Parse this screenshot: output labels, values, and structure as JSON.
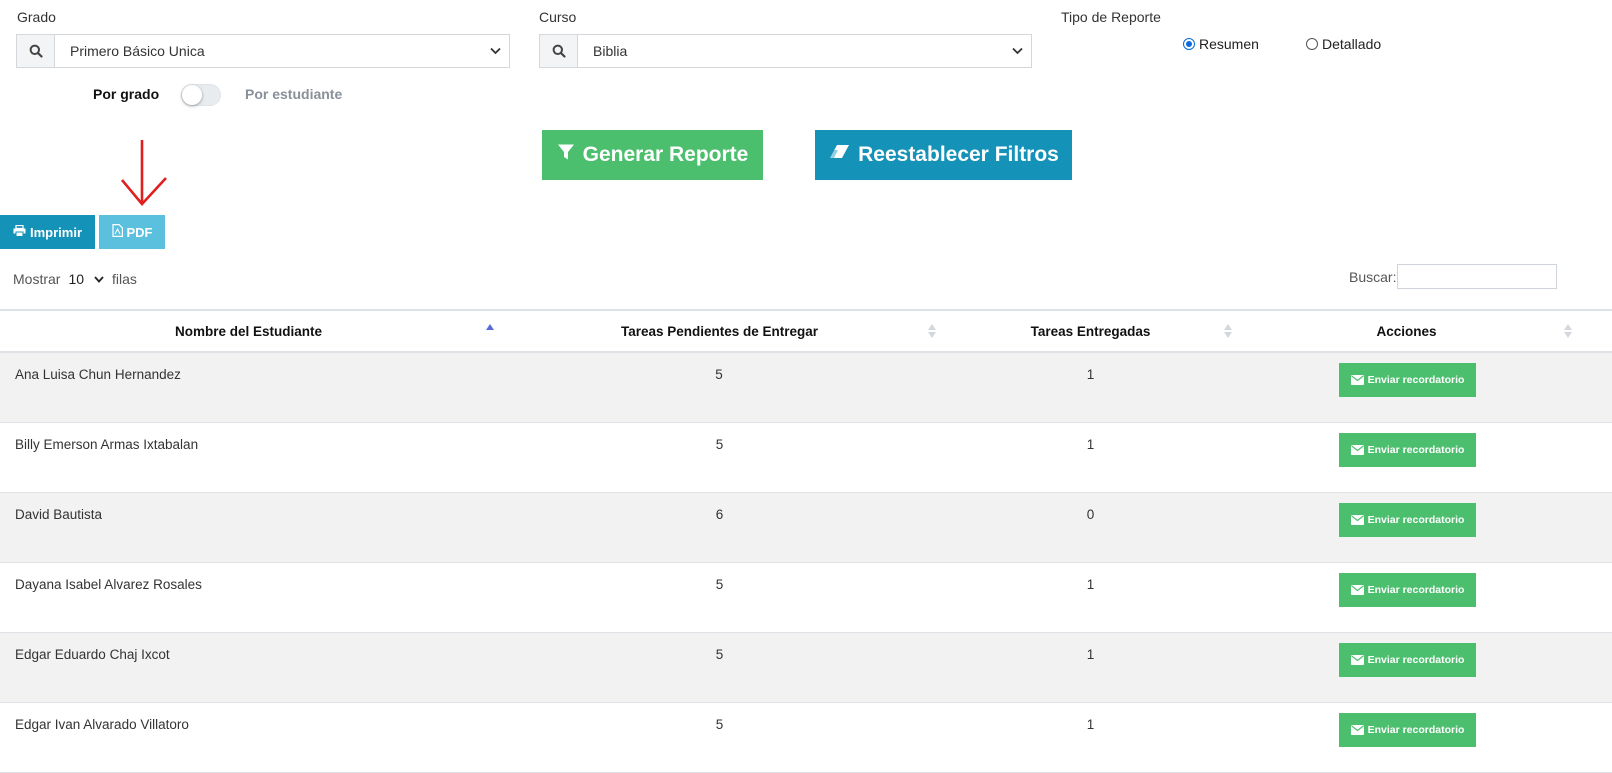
{
  "filters": {
    "grado": {
      "label": "Grado",
      "value": "Primero Básico Unica"
    },
    "curso": {
      "label": "Curso",
      "value": "Biblia"
    },
    "tipo_reporte": {
      "label": "Tipo de Reporte",
      "options": [
        {
          "label": "Resumen",
          "checked": true
        },
        {
          "label": "Detallado",
          "checked": false
        }
      ]
    },
    "toggle": {
      "left_label": "Por grado",
      "right_label": "Por estudiante"
    }
  },
  "actions": {
    "generar": "Generar Reporte",
    "reestablecer": "Reestablecer Filtros",
    "imprimir": "Imprimir",
    "pdf": "PDF"
  },
  "table_controls": {
    "mostrar": "Mostrar",
    "page_size": "10",
    "filas": "filas",
    "buscar": "Buscar:",
    "search_value": ""
  },
  "table": {
    "headers": [
      "Nombre del Estudiante",
      "Tareas Pendientes de Entregar",
      "Tareas Entregadas",
      "Acciones"
    ],
    "action_label": "Enviar recordatorio",
    "rows": [
      {
        "name": "Ana Luisa Chun Hernandez",
        "pendientes": "5",
        "entregadas": "1"
      },
      {
        "name": "Billy Emerson Armas Ixtabalan",
        "pendientes": "5",
        "entregadas": "1"
      },
      {
        "name": "David Bautista",
        "pendientes": "6",
        "entregadas": "0"
      },
      {
        "name": "Dayana Isabel Alvarez Rosales",
        "pendientes": "5",
        "entregadas": "1"
      },
      {
        "name": "Edgar Eduardo Chaj Ixcot",
        "pendientes": "5",
        "entregadas": "1"
      },
      {
        "name": "Edgar Ivan Alvarado Villatoro",
        "pendientes": "5",
        "entregadas": "1"
      }
    ]
  },
  "colors": {
    "green": "#4cbf6e",
    "teal": "#1492b8",
    "pdf": "#5bc0de",
    "annotation_red": "#e02020"
  }
}
